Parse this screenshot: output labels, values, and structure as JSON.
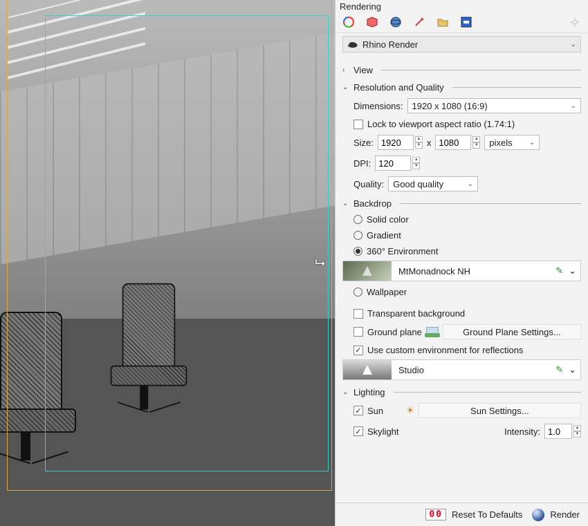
{
  "panel": {
    "title": "Rendering"
  },
  "renderer": {
    "name": "Rhino Render"
  },
  "sections": {
    "view": {
      "title": "View",
      "expanded": false
    },
    "resq": {
      "title": "Resolution and Quality",
      "dimensions_label": "Dimensions:",
      "dimensions_value": "1920 x 1080 (16:9)",
      "lock_label": "Lock to viewport aspect ratio (1.74:1)",
      "lock_checked": false,
      "size_label": "Size:",
      "width": "1920",
      "height": "1080",
      "x": "x",
      "units": "pixels",
      "dpi_label": "DPI:",
      "dpi": "120",
      "quality_label": "Quality:",
      "quality_value": "Good quality"
    },
    "backdrop": {
      "title": "Backdrop",
      "opt_solid": "Solid color",
      "opt_gradient": "Gradient",
      "opt_env": "360° Environment",
      "env_name": "MtMonadnock NH",
      "opt_wallpaper": "Wallpaper",
      "selected": "env",
      "transparent_label": "Transparent background",
      "transparent_checked": false,
      "ground_label": "Ground plane",
      "ground_checked": false,
      "ground_settings": "Ground Plane Settings...",
      "custom_refl_label": "Use custom environment for reflections",
      "custom_refl_checked": true,
      "refl_name": "Studio"
    },
    "lighting": {
      "title": "Lighting",
      "sun_label": "Sun",
      "sun_checked": true,
      "sun_settings": "Sun Settings...",
      "sky_label": "Skylight",
      "sky_checked": true,
      "intensity_label": "Intensity:",
      "intensity": "1.0"
    }
  },
  "footer": {
    "digits": "00",
    "reset": "Reset To Defaults",
    "render": "Render"
  }
}
